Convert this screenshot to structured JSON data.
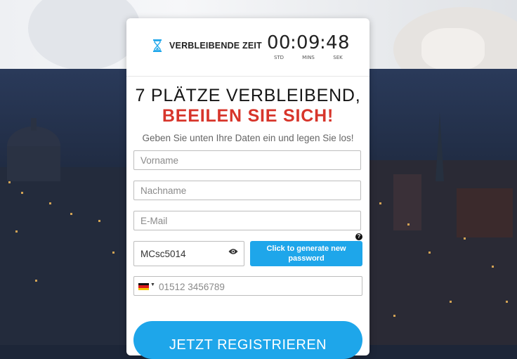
{
  "timer": {
    "label": "VERBLEIBENDE ZEIT",
    "hours": "00",
    "minutes": "09",
    "seconds": "48",
    "unit_hours": "STD",
    "unit_minutes": "MINS",
    "unit_seconds": "SEK",
    "icon": "hourglass-icon"
  },
  "headline": {
    "line1": "7 PLÄTZE VERBLEIBEND,",
    "line2": "BEEILEN SIE SICH!"
  },
  "subtext": "Geben Sie unten Ihre Daten ein und legen Sie los!",
  "form": {
    "firstname_placeholder": "Vorname",
    "lastname_placeholder": "Nachname",
    "email_placeholder": "E-Mail",
    "password_value": "MCsc5014",
    "generate_button": "Click to generate new password",
    "help_icon": "?",
    "phone_placeholder": "01512 3456789",
    "phone_country_icon": "germany-flag-icon",
    "submit_label": "JETZT REGISTRIEREN"
  },
  "colors": {
    "accent": "#1ea6ea",
    "headline_red": "#d7352b",
    "hourglass": "#1ea6ea"
  }
}
